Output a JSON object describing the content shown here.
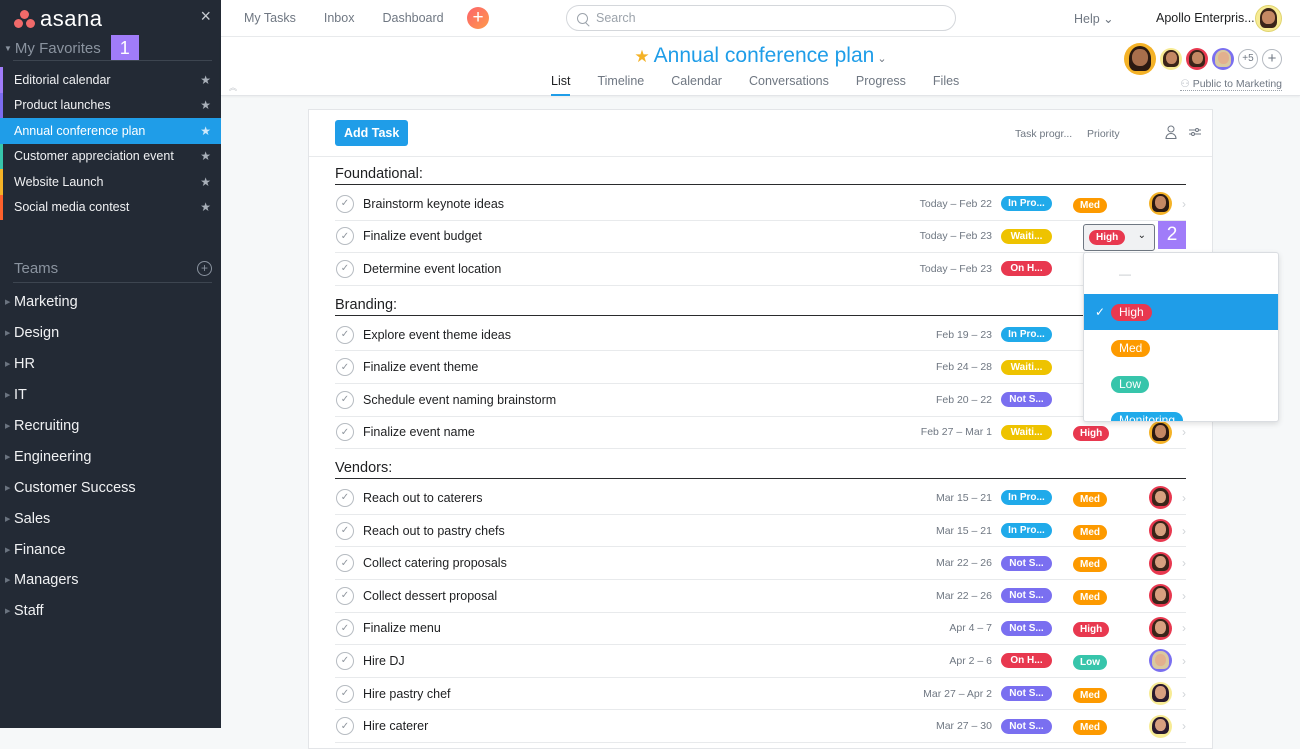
{
  "sidebar": {
    "logo_text": "asana",
    "close_label": "×",
    "favorites_label": "My Favorites",
    "favorites_badge": "1",
    "favorites": [
      {
        "label": "Editorial calendar",
        "color": "#a07cf9",
        "active": false
      },
      {
        "label": "Product launches",
        "color": "#7c6cf0",
        "active": false
      },
      {
        "label": "Annual conference plan",
        "color": "#1f9de8",
        "active": true
      },
      {
        "label": "Customer appreciation event",
        "color": "#37c5ab",
        "active": false
      },
      {
        "label": "Website Launch",
        "color": "#f4b227",
        "active": false
      },
      {
        "label": "Social media contest",
        "color": "#fd612c",
        "active": false
      }
    ],
    "teams_label": "Teams",
    "teams_add": "+",
    "teams": [
      "Marketing",
      "Design",
      "HR",
      "IT",
      "Recruiting",
      "Engineering",
      "Customer Success",
      "Sales",
      "Finance",
      "Managers",
      "Staff"
    ]
  },
  "topbar": {
    "nav": [
      "My Tasks",
      "Inbox",
      "Dashboard"
    ],
    "quick_add": "+",
    "search_placeholder": "Search",
    "help_label": "Help ⌄",
    "org_label": "Apollo Enterpris..."
  },
  "project": {
    "title": "Annual conference plan",
    "star": "★",
    "chevron": "⌄",
    "tabs": [
      {
        "label": "List",
        "active": true
      },
      {
        "label": "Timeline",
        "active": false
      },
      {
        "label": "Calendar",
        "active": false
      },
      {
        "label": "Conversations",
        "active": false
      },
      {
        "label": "Progress",
        "active": false
      },
      {
        "label": "Files",
        "active": false
      }
    ],
    "members_more": "+5",
    "add_member": "+",
    "visibility": "Public to Marketing"
  },
  "toolbar": {
    "add_task": "Add Task",
    "col_progress": "Task progr...",
    "col_priority": "Priority"
  },
  "colors": {
    "In Pro...": "#20aaea",
    "Waiti...": "#eec300",
    "On H...": "#e8384f",
    "Not S...": "#7a6ff0",
    "High": "#e8384f",
    "Med": "#fd9a00",
    "Low": "#37c5ab",
    "Monitoring": "#20aaea"
  },
  "sections": [
    {
      "title": "Foundational:",
      "tasks": [
        {
          "name": "Brainstorm keynote ideas",
          "date": "Today – Feb 22",
          "status": "In Pro...",
          "priority": "Med",
          "avatar": "orange"
        },
        {
          "name": "Finalize event budget",
          "date": "Today – Feb 23",
          "status": "Waiti...",
          "priority": "High",
          "avatar": "none",
          "editing": true
        },
        {
          "name": "Determine event location",
          "date": "Today – Feb 23",
          "status": "On H...",
          "priority": "",
          "avatar": "none"
        }
      ]
    },
    {
      "title": "Branding:",
      "tasks": [
        {
          "name": "Explore event theme ideas",
          "date": "Feb 19 – 23",
          "status": "In Pro...",
          "priority": "",
          "avatar": "none"
        },
        {
          "name": "Finalize event theme",
          "date": "Feb 24 – 28",
          "status": "Waiti...",
          "priority": "",
          "avatar": "none"
        },
        {
          "name": "Schedule event naming brainstorm",
          "date": "Feb 20 – 22",
          "status": "Not S...",
          "priority": "",
          "avatar": "none"
        },
        {
          "name": "Finalize event name",
          "date": "Feb 27 – Mar 1",
          "status": "Waiti...",
          "priority": "High",
          "avatar": "orange"
        }
      ]
    },
    {
      "title": "Vendors:",
      "tasks": [
        {
          "name": "Reach out to caterers",
          "date": "Mar 15 – 21",
          "status": "In Pro...",
          "priority": "Med",
          "avatar": "red"
        },
        {
          "name": "Reach out to pastry chefs",
          "date": "Mar 15 – 21",
          "status": "In Pro...",
          "priority": "Med",
          "avatar": "red"
        },
        {
          "name": "Collect catering proposals",
          "date": "Mar 22 – 26",
          "status": "Not S...",
          "priority": "Med",
          "avatar": "red"
        },
        {
          "name": "Collect dessert proposal",
          "date": "Mar 22 – 26",
          "status": "Not S...",
          "priority": "Med",
          "avatar": "red"
        },
        {
          "name": "Finalize menu",
          "date": "Apr 4 – 7",
          "status": "Not S...",
          "priority": "High",
          "avatar": "red"
        },
        {
          "name": "Hire DJ",
          "date": "Apr 2 – 6",
          "status": "On H...",
          "priority": "Low",
          "avatar": "blue"
        },
        {
          "name": "Hire pastry chef",
          "date": "Mar 27 – Apr 2",
          "status": "Not S...",
          "priority": "Med",
          "avatar": "yellow"
        },
        {
          "name": "Hire caterer",
          "date": "Mar 27 – 30",
          "status": "Not S...",
          "priority": "Med",
          "avatar": "yellow"
        }
      ]
    }
  ],
  "priority_dropdown": {
    "selected": "High",
    "badge": "2",
    "caret": "⌄",
    "none_option": "—",
    "options": [
      "High",
      "Med",
      "Low",
      "Monitoring"
    ],
    "check": "✓"
  }
}
